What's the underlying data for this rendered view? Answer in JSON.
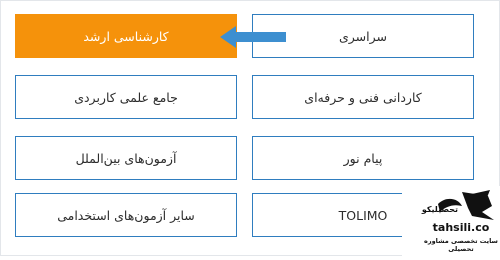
{
  "colors": {
    "tile_border": "#2f7dbf",
    "active_bg": "#f5920b",
    "arrow": "#3d8fd0",
    "text": "#2c2c2c"
  },
  "tiles": [
    {
      "label": "سراسری",
      "active": false
    },
    {
      "label": "کارشناسی ارشد",
      "active": true
    },
    {
      "label": "کاردانی فنی و حرفه‌ای",
      "active": false
    },
    {
      "label": "جامع علمی کاربردی",
      "active": false
    },
    {
      "label": "پیام نور",
      "active": false
    },
    {
      "label": "آزمون‌های بین‌الملل",
      "active": false
    },
    {
      "label": "TOLIMO",
      "active": false
    },
    {
      "label": "سایر آزمون‌های استخدامی",
      "active": false
    }
  ],
  "arrow_icon": "left-arrow-icon",
  "logo": {
    "brand": "tahsili.co",
    "fa_name": "تحصیلیکو",
    "tagline": "سایت تخصصی مشاوره تحصیلی"
  }
}
